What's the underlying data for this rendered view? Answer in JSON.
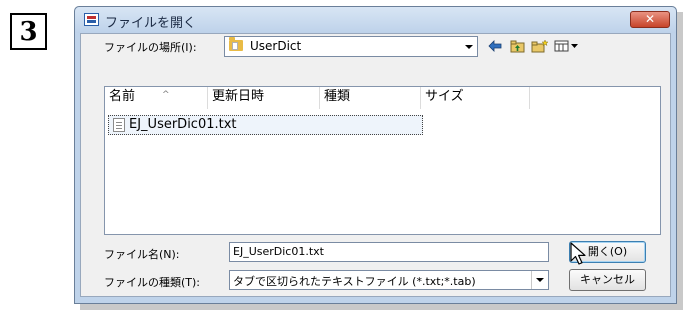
{
  "step_number": "3",
  "dialog": {
    "title": "ファイルを開く",
    "close_label": "✕",
    "location_label": "ファイルの場所(I):",
    "location_value": "UserDict",
    "toolbar_icons": [
      "back-arrow-icon",
      "up-folder-icon",
      "new-folder-icon",
      "view-menu-icon"
    ],
    "columns": [
      "名前",
      "更新日時",
      "種類",
      "サイズ"
    ],
    "sort_indicator": "^",
    "files": [
      {
        "name": "EJ_UserDic01.txt",
        "selected": true
      }
    ],
    "filename_label": "ファイル名(N):",
    "filename_value": "EJ_UserDic01.txt",
    "filetype_label": "ファイルの種類(T):",
    "filetype_value": "タブで区切られたテキストファイル (*.txt;*.tab)",
    "open_button": "開く(O)",
    "cancel_button": "キャンセル"
  },
  "colors": {
    "title_bar": "#bed2ea",
    "close_button": "#c7442a",
    "selection": "#eef4fb"
  }
}
